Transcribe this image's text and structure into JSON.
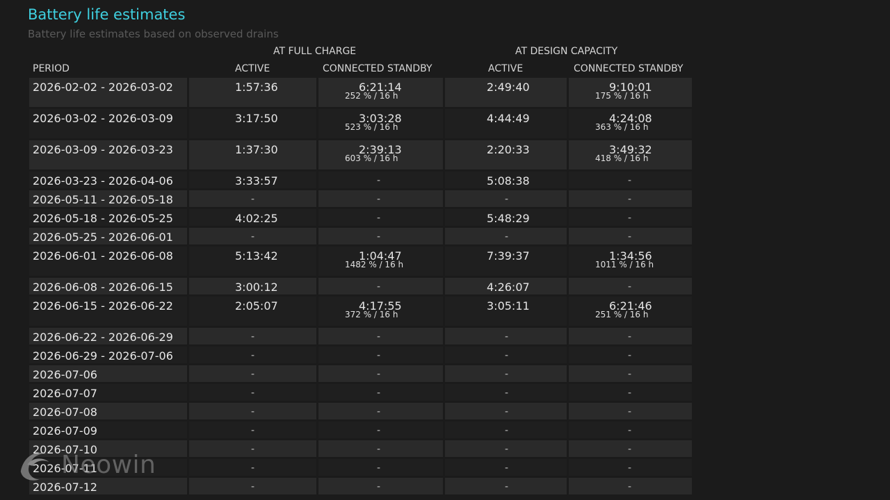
{
  "report": {
    "title": "Battery life estimates",
    "subtitle": "Battery life estimates based on observed drains"
  },
  "table": {
    "group_full_charge": "AT FULL CHARGE",
    "group_design_capacity": "AT DESIGN CAPACITY",
    "col_period": "PERIOD",
    "col_active_full": "ACTIVE",
    "col_standby_full": "CONNECTED STANDBY",
    "col_active_design": "ACTIVE",
    "col_standby_design": "CONNECTED STANDBY",
    "rows": [
      {
        "period": "2026-02-02 - 2026-03-02",
        "active_full": "1:57:36",
        "standby_full": "6:21:14",
        "standby_full_sub": "252 % / 16 h",
        "active_design": "2:49:40",
        "standby_design": "9:10:01",
        "standby_design_sub": "175 % / 16 h"
      },
      {
        "period": "2026-03-02 - 2026-03-09",
        "active_full": "3:17:50",
        "standby_full": "3:03:28",
        "standby_full_sub": "523 % / 16 h",
        "active_design": "4:44:49",
        "standby_design": "4:24:08",
        "standby_design_sub": "363 % / 16 h"
      },
      {
        "period": "2026-03-09 - 2026-03-23",
        "active_full": "1:37:30",
        "standby_full": "2:39:13",
        "standby_full_sub": "603 % / 16 h",
        "active_design": "2:20:33",
        "standby_design": "3:49:32",
        "standby_design_sub": "418 % / 16 h"
      },
      {
        "period": "2026-03-23 - 2026-04-06",
        "active_full": "3:33:57",
        "standby_full": "-",
        "standby_full_sub": "",
        "active_design": "5:08:38",
        "standby_design": "-",
        "standby_design_sub": ""
      },
      {
        "period": "2026-05-11 - 2026-05-18",
        "active_full": "-",
        "standby_full": "-",
        "standby_full_sub": "",
        "active_design": "-",
        "standby_design": "-",
        "standby_design_sub": ""
      },
      {
        "period": "2026-05-18 - 2026-05-25",
        "active_full": "4:02:25",
        "standby_full": "-",
        "standby_full_sub": "",
        "active_design": "5:48:29",
        "standby_design": "-",
        "standby_design_sub": ""
      },
      {
        "period": "2026-05-25 - 2026-06-01",
        "active_full": "-",
        "standby_full": "-",
        "standby_full_sub": "",
        "active_design": "-",
        "standby_design": "-",
        "standby_design_sub": ""
      },
      {
        "period": "2026-06-01 - 2026-06-08",
        "active_full": "5:13:42",
        "standby_full": "1:04:47",
        "standby_full_sub": "1482 % / 16 h",
        "active_design": "7:39:37",
        "standby_design": "1:34:56",
        "standby_design_sub": "1011 % / 16 h"
      },
      {
        "period": "2026-06-08 - 2026-06-15",
        "active_full": "3:00:12",
        "standby_full": "-",
        "standby_full_sub": "",
        "active_design": "4:26:07",
        "standby_design": "-",
        "standby_design_sub": ""
      },
      {
        "period": "2026-06-15 - 2026-06-22",
        "active_full": "2:05:07",
        "standby_full": "4:17:55",
        "standby_full_sub": "372 % / 16 h",
        "active_design": "3:05:11",
        "standby_design": "6:21:46",
        "standby_design_sub": "251 % / 16 h"
      },
      {
        "period": "2026-06-22 - 2026-06-29",
        "active_full": "-",
        "standby_full": "-",
        "standby_full_sub": "",
        "active_design": "-",
        "standby_design": "-",
        "standby_design_sub": ""
      },
      {
        "period": "2026-06-29 - 2026-07-06",
        "active_full": "-",
        "standby_full": "-",
        "standby_full_sub": "",
        "active_design": "-",
        "standby_design": "-",
        "standby_design_sub": ""
      },
      {
        "period": "2026-07-06",
        "active_full": "-",
        "standby_full": "-",
        "standby_full_sub": "",
        "active_design": "-",
        "standby_design": "-",
        "standby_design_sub": ""
      },
      {
        "period": "2026-07-07",
        "active_full": "-",
        "standby_full": "-",
        "standby_full_sub": "",
        "active_design": "-",
        "standby_design": "-",
        "standby_design_sub": ""
      },
      {
        "period": "2026-07-08",
        "active_full": "-",
        "standby_full": "-",
        "standby_full_sub": "",
        "active_design": "-",
        "standby_design": "-",
        "standby_design_sub": ""
      },
      {
        "period": "2026-07-09",
        "active_full": "-",
        "standby_full": "-",
        "standby_full_sub": "",
        "active_design": "-",
        "standby_design": "-",
        "standby_design_sub": ""
      },
      {
        "period": "2026-07-10",
        "active_full": "-",
        "standby_full": "-",
        "standby_full_sub": "",
        "active_design": "-",
        "standby_design": "-",
        "standby_design_sub": ""
      },
      {
        "period": "2026-07-11",
        "active_full": "-",
        "standby_full": "-",
        "standby_full_sub": "",
        "active_design": "-",
        "standby_design": "-",
        "standby_design_sub": ""
      },
      {
        "period": "2026-07-12",
        "active_full": "-",
        "standby_full": "-",
        "standby_full_sub": "",
        "active_design": "-",
        "standby_design": "-",
        "standby_design_sub": ""
      }
    ]
  },
  "watermark": {
    "text": "Neowin",
    "icon": "neowin-logo-icon"
  }
}
